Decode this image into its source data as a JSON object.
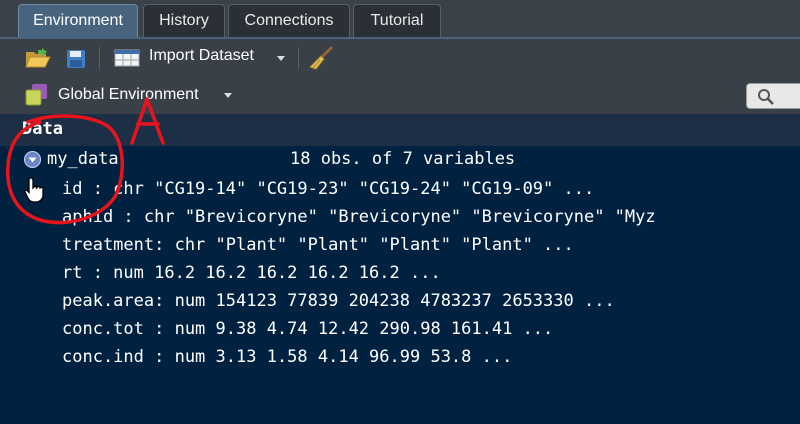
{
  "tabs": [
    {
      "label": "Environment",
      "active": true
    },
    {
      "label": "History",
      "active": false
    },
    {
      "label": "Connections",
      "active": false
    },
    {
      "label": "Tutorial",
      "active": false
    }
  ],
  "toolbar": {
    "import_label": "Import Dataset",
    "icons": [
      "open-folder-icon",
      "save-icon",
      "import-dataset-icon",
      "broom-icon"
    ]
  },
  "env": {
    "selected": "Global Environment"
  },
  "data_section": {
    "header": "Data",
    "object": {
      "name": "my_data",
      "summary": "18 obs. of 7 variables",
      "variables": [
        "id : chr \"CG19-14\" \"CG19-23\" \"CG19-24\" \"CG19-09\" ...",
        "aphid : chr \"Brevicoryne\" \"Brevicoryne\" \"Brevicoryne\" \"Myz",
        "treatment: chr \"Plant\" \"Plant\" \"Plant\" \"Plant\" ...",
        "rt : num 16.2 16.2 16.2 16.2 16.2 ...",
        "peak.area: num 154123 77839 204238 4783237 2653330 ...",
        "conc.tot : num 9.38 4.74 12.42 290.98 161.41 ...",
        "conc.ind : num 3.13 1.58 4.14 96.99 53.8 ..."
      ]
    }
  },
  "annotation": {
    "letter": "A",
    "color": "#e8141c"
  }
}
